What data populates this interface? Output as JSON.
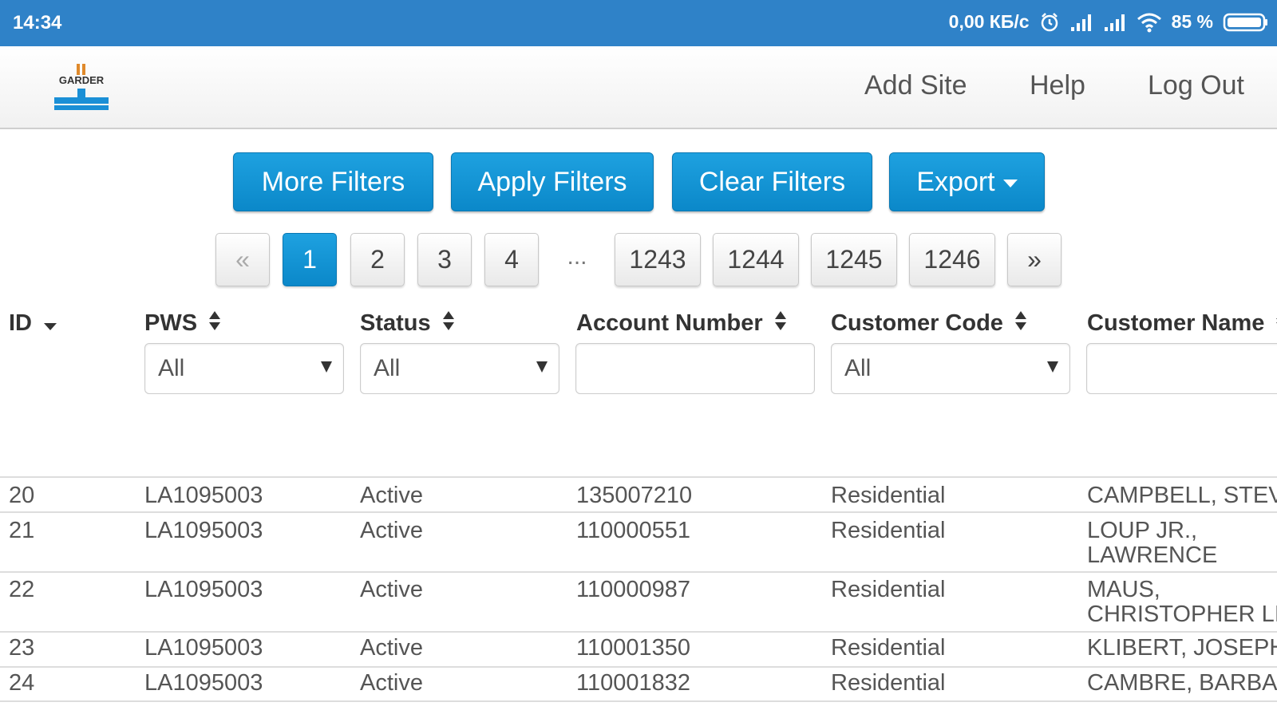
{
  "status_bar": {
    "time": "14:34",
    "network_speed": "0,00 КБ/с",
    "battery": "85 %",
    "icons": [
      "alarm-icon",
      "signal-icon",
      "signal-icon",
      "wifi-icon",
      "battery-icon"
    ]
  },
  "header": {
    "logo_text": "GARDER",
    "nav": {
      "add_site": "Add Site",
      "help": "Help",
      "log_out": "Log Out"
    }
  },
  "toolbar": {
    "more_filters": "More Filters",
    "apply_filters": "Apply Filters",
    "clear_filters": "Clear Filters",
    "export": "Export"
  },
  "pagination": {
    "prev": "«",
    "pages_start": [
      "1",
      "2",
      "3",
      "4"
    ],
    "ellipsis": "...",
    "pages_end": [
      "1243",
      "1244",
      "1245",
      "1246"
    ],
    "next": "»",
    "current": "1"
  },
  "table": {
    "columns": {
      "id": "ID",
      "pws": "PWS",
      "status": "Status",
      "account_number": "Account Number",
      "customer_code": "Customer Code",
      "customer_name": "Customer Name"
    },
    "filters": {
      "pws": "All",
      "status": "All",
      "account_number": "",
      "customer_code": "All",
      "customer_name": ""
    },
    "rows": [
      {
        "id": "20",
        "pws": "LA1095003",
        "status": "Active",
        "account": "135007210",
        "code": "Residential",
        "name": "CAMPBELL, STEV"
      },
      {
        "id": "21",
        "pws": "LA1095003",
        "status": "Active",
        "account": "110000551",
        "code": "Residential",
        "name": "LOUP JR., LAWRENCE"
      },
      {
        "id": "22",
        "pws": "LA1095003",
        "status": "Active",
        "account": "110000987",
        "code": "Residential",
        "name": "MAUS, CHRISTOPHER LI"
      },
      {
        "id": "23",
        "pws": "LA1095003",
        "status": "Active",
        "account": "110001350",
        "code": "Residential",
        "name": "KLIBERT, JOSEPH"
      },
      {
        "id": "24",
        "pws": "LA1095003",
        "status": "Active",
        "account": "110001832",
        "code": "Residential",
        "name": "CAMBRE, BARBA"
      }
    ]
  },
  "colors": {
    "status_bar": "#2f82c8",
    "primary_button": "#0b88c9",
    "logo_blue": "#1a8fd6",
    "logo_orange": "#e08a2c"
  }
}
